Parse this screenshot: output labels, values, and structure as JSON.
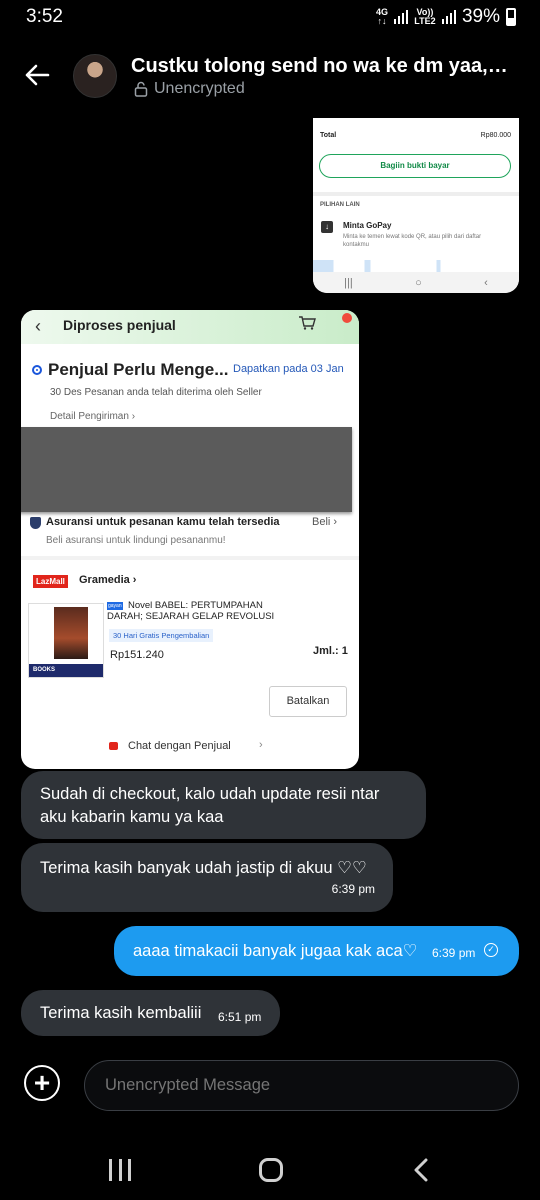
{
  "status_bar": {
    "time": "3:52",
    "network_top": "4G",
    "network_bottom": "Vo)) LTE2",
    "battery": "39%"
  },
  "header": {
    "title": "Custku tolong send no wa ke dm yaa, K…",
    "subtitle": "Unencrypted"
  },
  "screenshot1": {
    "total_label": "Total",
    "total_value": "Rp80.000",
    "share_button": "Bagiin bukti bayar",
    "section_label": "PILIHAN LAIN",
    "option_title": "Minta GoPay",
    "option_desc": "Minta ke temen lewat kode QR, atau pilih dari daftar kontakmu"
  },
  "screenshot2": {
    "header_title": "Diproses penjual",
    "headline": "Penjual Perlu Menge...",
    "eta": "Dapatkan pada 03 Jan",
    "status_line": "30 Des Pesanan anda telah diterima oleh Seller",
    "detail_link": "Detail Pengiriman",
    "insurance_title": "Asuransi untuk pesanan kamu telah tersedia",
    "insurance_action": "Beli",
    "insurance_sub": "Beli asuransi untuk lindungi pesananmu!",
    "mall_badge": "LazMall",
    "store_name": "Gramedia",
    "product_tag": "gayan",
    "product_name": "Novel BABEL: PERTUMPAHAN DARAH; SEJARAH GELAP REVOLUSI",
    "return_badge": "30 Hari Gratis Pengembalian",
    "price": "Rp151.240",
    "qty": "Jml.: 1",
    "cover_label": "BOOKS",
    "cancel_button": "Batalkan",
    "chat_link": "Chat dengan Penjual"
  },
  "messages": [
    {
      "text": "Sudah di checkout, kalo udah update resii ntar aku kabarin kamu ya kaa",
      "time": ""
    },
    {
      "text": "Terima kasih banyak udah jastip di akuu ♡♡",
      "time": "6:39 pm"
    },
    {
      "text": "aaaa timakacii banyak jugaa kak aca♡",
      "time": "6:39 pm"
    },
    {
      "text": "Terima kasih kembaliii",
      "time": "6:51 pm"
    }
  ],
  "composer": {
    "placeholder": "Unencrypted Message"
  },
  "colors": {
    "background": "#000000",
    "incoming_bubble": "#2f3338",
    "outgoing_bubble": "#1d9bf0"
  }
}
